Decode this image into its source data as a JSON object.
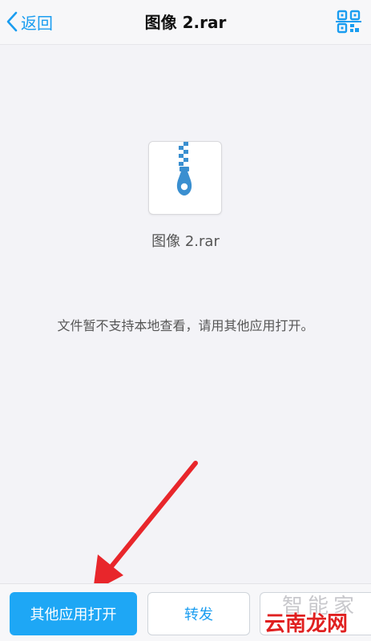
{
  "navbar": {
    "back_label": "返回",
    "title": "图像 2.rar",
    "accent_color": "#1a9df0"
  },
  "file": {
    "name": "图像 2.rar",
    "icon": "zip-archive-icon"
  },
  "message": "文件暂不支持本地查看，请用其他应用打开。",
  "actions": {
    "open_with_other_label": "其他应用打开",
    "forward_label": "转发"
  },
  "watermark": {
    "top": "智能家",
    "bottom": "云南龙网"
  },
  "colors": {
    "primary_button": "#1ea7f5",
    "annotation_arrow": "#e8262b"
  }
}
